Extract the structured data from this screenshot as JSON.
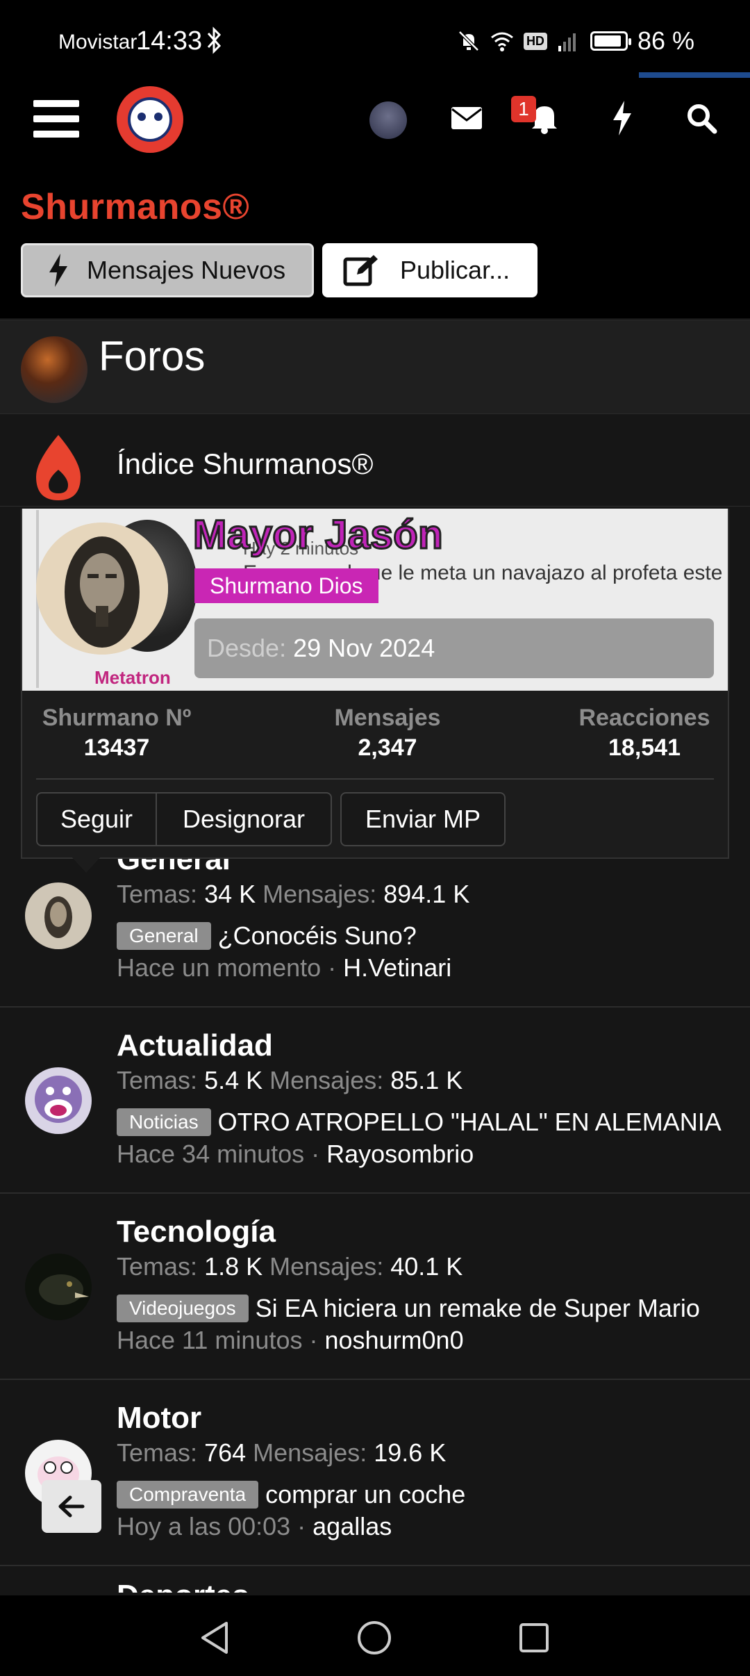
{
  "status_bar": {
    "carrier": "Movistar",
    "time": "14:33",
    "network_badge": "HD",
    "battery": "86 %"
  },
  "header": {
    "notification_count": "1",
    "brand": "Shurmanos®",
    "new_posts_button": "Mensajes Nuevos",
    "publish_button": "Publicar..."
  },
  "section": {
    "title": "Foros",
    "category": "Índice Shurmanos®"
  },
  "popup": {
    "banner_line1": "Hay 2 minutos",
    "banner_line2": "En nayes al que le meta un navajazo al profeta este",
    "avatar_caption": "Metatron",
    "username": "Mayor Jasón",
    "role": "Shurmano Dios",
    "since_label": "Desde:",
    "since_value": "29 Nov 2024",
    "stats": [
      {
        "label": "Shurmano Nº",
        "value": "13437"
      },
      {
        "label": "Mensajes",
        "value": "2,347"
      },
      {
        "label": "Reacciones",
        "value": "18,541"
      }
    ],
    "buttons": {
      "follow": "Seguir",
      "unignore": "Designorar",
      "message": "Enviar MP"
    }
  },
  "forums": [
    {
      "title": "General",
      "topics_label": "Temas:",
      "topics": "34 K",
      "posts_label": "Mensajes:",
      "posts": "894.1 K",
      "tag": "General",
      "latest": "¿Conocéis Suno?",
      "when": "Hace un momento",
      "user": "H.Vetinari"
    },
    {
      "title": "Actualidad",
      "topics_label": "Temas:",
      "topics": "5.4 K",
      "posts_label": "Mensajes:",
      "posts": "85.1 K",
      "tag": "Noticias",
      "latest": "OTRO ATROPELLO \"HALAL\" EN ALEMANIA",
      "when": "Hace 34 minutos",
      "user": "Rayosombrio"
    },
    {
      "title": "Tecnología",
      "topics_label": "Temas:",
      "topics": "1.8 K",
      "posts_label": "Mensajes:",
      "posts": "40.1 K",
      "tag": "Videojuegos",
      "latest": "Si EA hiciera un remake de Super Mario",
      "when": "Hace 11 minutos",
      "user": "noshurm0n0"
    },
    {
      "title": "Motor",
      "topics_label": "Temas:",
      "topics": "764",
      "posts_label": "Mensajes:",
      "posts": "19.6 K",
      "tag": "Compraventa",
      "latest": "comprar un coche",
      "when": "Hoy a las 00:03",
      "user": "agallas"
    }
  ],
  "next_forum_partial": "Deportes",
  "colors": {
    "brand": "#e8442f",
    "role_badge": "#c926b4",
    "notification": "#e0342b"
  }
}
